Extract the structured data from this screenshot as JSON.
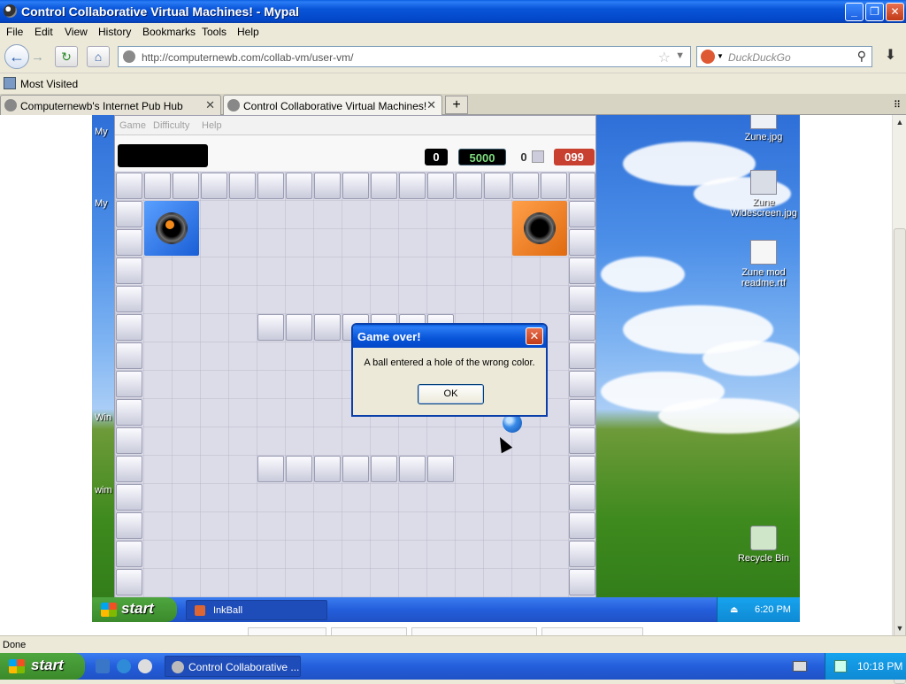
{
  "window": {
    "title": "Control Collaborative Virtual Machines! - Mypal"
  },
  "menu": [
    "File",
    "Edit",
    "View",
    "History",
    "Bookmarks",
    "Tools",
    "Help"
  ],
  "nav": {
    "url": "http://computernewb.com/collab-vm/user-vm/",
    "search_placeholder": "DuckDuckGo"
  },
  "bookmarks": {
    "label": "Most Visited"
  },
  "tabs": [
    {
      "label": "Computernewb's Internet Pub Hub"
    },
    {
      "label": "Control Collaborative Virtual Machines!"
    }
  ],
  "vm": {
    "inkball_menu": [
      "Game",
      "Difficulty",
      "Help"
    ],
    "scores": {
      "a": "0",
      "b": "5000",
      "c": "0",
      "d": "099"
    },
    "left_labels": [
      "My",
      "My",
      "Win",
      "wim"
    ],
    "desktop_icons": [
      "Zune.jpg",
      "Zune Widescreen.jpg",
      "Zune mod readme.rtf",
      "Recycle Bin"
    ],
    "dialog": {
      "title": "Game over!",
      "message": "A ball entered a hole of the wrong color.",
      "ok": "OK"
    },
    "taskbar": {
      "start": "start",
      "task": "InkBall",
      "clock": "6:20 PM"
    }
  },
  "status": {
    "text": "Done"
  },
  "host_taskbar": {
    "start": "start",
    "task": "Control Collaborative ...",
    "clock": "10:18 PM"
  }
}
